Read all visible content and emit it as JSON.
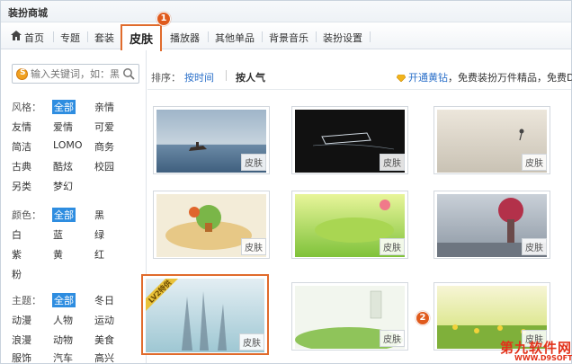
{
  "window": {
    "title": "装扮商城"
  },
  "nav": {
    "items": [
      "首页",
      "专题",
      "套装",
      "皮肤",
      "播放器",
      "其他单品",
      "背景音乐",
      "装扮设置"
    ],
    "active": "皮肤",
    "badge_active": "1"
  },
  "search": {
    "placeholder": "输入关键词，如：黑"
  },
  "filters": {
    "style_label": "风格：",
    "style_options": [
      "全部",
      "亲情",
      "友情",
      "爱情",
      "可爱",
      "简洁",
      "LOMO",
      "商务",
      "古典",
      "酷炫",
      "校园",
      "另类",
      "梦幻"
    ],
    "color_label": "颜色：",
    "color_options": [
      "全部",
      "黑",
      "白",
      "蓝",
      "绿",
      "紫",
      "黄",
      "红",
      "粉"
    ],
    "theme_label": "主题：",
    "theme_options": [
      "全部",
      "冬日",
      "动漫",
      "人物",
      "运动",
      "浪漫",
      "动物",
      "美食",
      "服饰",
      "汽车",
      "高兴"
    ]
  },
  "sort": {
    "label": "排序：",
    "by_time": "按时间",
    "by_popularity": "按人气"
  },
  "promo": {
    "link": "开通黄钻",
    "text": "，免费装扮万件精品，免费DIY"
  },
  "thumbnails": [
    {
      "tag": "皮肤"
    },
    {
      "tag": "皮肤"
    },
    {
      "tag": "皮肤"
    },
    {
      "tag": "皮肤"
    },
    {
      "tag": "皮肤"
    },
    {
      "tag": "皮肤"
    },
    {
      "tag": "皮肤",
      "ribbon": "LV2特供"
    },
    {
      "tag": "皮肤"
    },
    {
      "tag": "皮肤"
    }
  ],
  "badge_thumb": "2",
  "watermark": {
    "line1": "第九软件网",
    "line2": "WWW.D9SOFT.COM"
  },
  "colors": {
    "accent_orange": "#e06b2c",
    "selected_blue": "#2e8de0",
    "link_blue": "#2a6fc9"
  }
}
